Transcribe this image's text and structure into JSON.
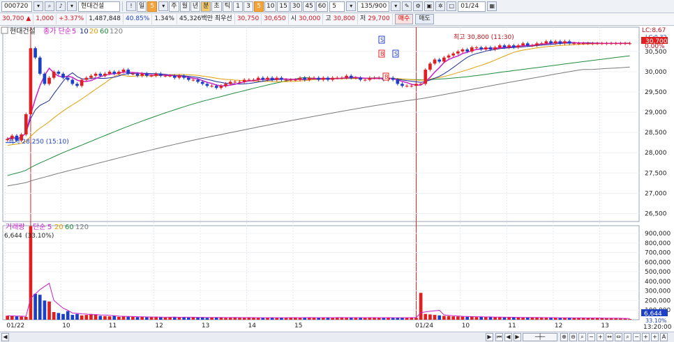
{
  "toolbar": {
    "code": "000720",
    "name": "현대건설",
    "period_buttons": [
      "일",
      "5",
      "주",
      "월",
      "년",
      "분",
      "초",
      "틱",
      "1",
      "3",
      "5",
      "10",
      "15",
      "30",
      "45",
      "60"
    ],
    "interval_value": "5",
    "count": "135",
    "count_total": "/900",
    "date": "01/24"
  },
  "quote": {
    "price": "30,700",
    "change_arrow": "▲",
    "change": "1,000",
    "change_pct": "+3.37%",
    "volume": "1,487,848",
    "vol_ratio": "40.85%",
    "turnover": "1.34%",
    "amount": "45,326백만",
    "ask_label": "최우선",
    "ask": "30,750",
    "bid": "30,650",
    "open_label": "시",
    "open": "30,000",
    "high_label": "고",
    "high": "30,800",
    "low_label": "저",
    "low": "29,700",
    "buy_label": "매수",
    "sell_label": "매도"
  },
  "colors": {
    "up": "#e02020",
    "down": "#1c3fc4",
    "ma5": "#c81ec8",
    "ma10": "#1a2a9c",
    "ma20": "#e0a000",
    "ma60": "#1e8c3c",
    "ma120": "#7a7a7a",
    "vol_ma": "#c81ec8"
  },
  "chart_data": [
    {
      "type": "candlestick",
      "title": "현대건설",
      "legend": [
        "종가 단순",
        "5",
        "10",
        "20",
        "60",
        "120"
      ],
      "ylim": [
        26300,
        31100
      ],
      "y_ticks": [
        26500,
        27000,
        27500,
        28000,
        28500,
        29000,
        29500,
        30000,
        30500
      ],
      "y_tick_labels": [
        "26,500",
        "27,000",
        "27,500",
        "28,000",
        "28,500",
        "29,000",
        "29,500",
        "30,000",
        "30,500"
      ],
      "x_tick_labels": [
        "01/22",
        "10",
        "11",
        "12",
        "13",
        "14",
        "15",
        "01/24",
        "10",
        "11",
        "12",
        "13"
      ],
      "annotations": {
        "high": "최고 30,800 (11:30)",
        "low": "최저 28,250 (15:10)",
        "lc_top": "LC:8.67",
        "lc_bottom": "LC:0.32",
        "pct": "0.00%",
        "price_tag": "30,700",
        "markers": [
          "S",
          "B",
          "S",
          "B"
        ]
      },
      "close": [
        28340,
        28420,
        28300,
        28450,
        28950,
        30580,
        30350,
        29950,
        29700,
        29850,
        30000,
        29950,
        29850,
        29800,
        29700,
        29650,
        29800,
        29850,
        29900,
        29950,
        29900,
        29950,
        30000,
        29950,
        30000,
        30050,
        29950,
        29950,
        29900,
        29950,
        29900,
        29900,
        29950,
        29900,
        29900,
        29900,
        29850,
        29900,
        29850,
        29800,
        29800,
        29750,
        29700,
        29650,
        29650,
        29600,
        29650,
        29700,
        29750,
        29750,
        29750,
        29800,
        29800,
        29800,
        29850,
        29800,
        29850,
        29800,
        29850,
        29800,
        29800,
        29800,
        29800,
        29850,
        29800,
        29850,
        29850,
        29800,
        29850,
        29800,
        29850,
        29850,
        29850,
        29900,
        29850,
        29850,
        29800,
        29800,
        29850,
        29850,
        29850,
        29800,
        29850,
        29800,
        29700,
        29650,
        29650,
        29650,
        29700,
        29700,
        30050,
        30200,
        30300,
        30250,
        30350,
        30400,
        30450,
        30500,
        30550,
        30500,
        30600,
        30600,
        30550,
        30600,
        30550,
        30600,
        30650,
        30600,
        30650,
        30600,
        30650,
        30700,
        30650,
        30650,
        30700,
        30700,
        30750,
        30700,
        30750,
        30700,
        30750,
        30700,
        30700,
        30700,
        30700,
        30700,
        30700,
        30700,
        30700,
        30700,
        30700,
        30700,
        30700,
        30700,
        30700
      ],
      "series": [
        {
          "name": "5",
          "role": "ma5"
        },
        {
          "name": "10",
          "role": "ma10"
        },
        {
          "name": "20",
          "role": "ma20"
        },
        {
          "name": "60",
          "role": "ma60"
        },
        {
          "name": "120",
          "role": "ma120"
        }
      ]
    },
    {
      "type": "bar",
      "title": "거래량",
      "legend": [
        "거래량",
        "단순",
        "5",
        "20",
        "60",
        "120"
      ],
      "ylim": [
        0,
        980000
      ],
      "y_ticks": [
        100000,
        200000,
        300000,
        400000,
        500000,
        600000,
        700000,
        800000,
        900000
      ],
      "y_tick_labels": [
        "100,000",
        "200,000",
        "300,000",
        "400,000",
        "500,000",
        "600,000",
        "700,000",
        "800,000",
        "900,000"
      ],
      "info": "6,644",
      "info_pct": "(33.10%)",
      "last_tag": "6,644",
      "last_pct": "33.10%",
      "time_label": "13:20:00",
      "values": [
        42000,
        38000,
        35000,
        33000,
        30000,
        975000,
        270000,
        260000,
        200000,
        190000,
        80000,
        70000,
        60000,
        90000,
        50000,
        60000,
        45000,
        50000,
        60000,
        55000,
        40000,
        38000,
        35000,
        42000,
        30000,
        33000,
        32000,
        30000,
        28000,
        30000,
        25000,
        28000,
        30000,
        25000,
        22000,
        26000,
        30000,
        24000,
        28000,
        22000,
        25000,
        24000,
        26000,
        20000,
        22000,
        24000,
        25000,
        20000,
        22000,
        24000,
        20000,
        22000,
        23000,
        20000,
        22000,
        18000,
        21000,
        24000,
        22000,
        20000,
        19000,
        25000,
        22000,
        20000,
        24000,
        22000,
        20000,
        21000,
        23000,
        22000,
        20000,
        25000,
        22000,
        21000,
        20000,
        22000,
        24000,
        20000,
        22000,
        21000,
        20000,
        22000,
        23000,
        20000,
        22000,
        20000,
        22000,
        24000,
        20000,
        280000,
        60000,
        55000,
        50000,
        45000,
        40000,
        38000,
        35000,
        34000,
        32000,
        30000,
        32000,
        28000,
        30000,
        26000,
        28000,
        27000,
        25000,
        24000,
        26000,
        25000,
        24000,
        22000,
        23000,
        24000,
        22000,
        20000,
        21000,
        22000,
        20000,
        19000,
        20000,
        18000,
        19000,
        20000,
        18000,
        17000,
        16000,
        18000,
        17000,
        16000,
        15000,
        14000,
        13000,
        12000,
        6644
      ]
    }
  ]
}
